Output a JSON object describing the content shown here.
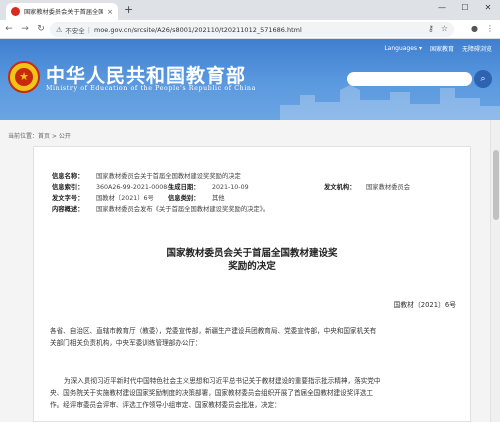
{
  "browser": {
    "tab_title": "国家教材委员会关于首届全国教材...",
    "close_glyph": "×",
    "newtab_glyph": "+",
    "window_controls": [
      "—",
      "☐",
      "✕"
    ],
    "back_glyph": "←",
    "forward_glyph": "→",
    "reload_glyph": "↻",
    "insecure_label": "不安全",
    "separator": "|",
    "url": "moe.gov.cn/srcsite/A26/s8001/202110/t20211012_571686.html",
    "icons": [
      "key-icon",
      "star-icon"
    ],
    "icon_glyphs": {
      "key": "⚷",
      "star": "☆",
      "account": "●",
      "menu": "⋮"
    }
  },
  "header": {
    "title": "中华人民共和国教育部",
    "subtitle": "Ministry of Education of the People's Republic of China",
    "links": [
      "Languages ▾",
      "国家教育",
      "无障碍浏览"
    ],
    "search_glyph": "⌕",
    "emblem_glyph": "★",
    "colors": {
      "top": "#3f7fcf",
      "bottom": "#6aa5e3"
    }
  },
  "breadcrumb": "当前位置：首页 > 公开",
  "meta": {
    "l_name": "信息名称：",
    "v_name": "国家教材委员会关于首届全国教材建设奖奖励的决定",
    "l_index": "信息索引：",
    "v_index": "360A26-99-2021-0008-1",
    "l_date": "生成日期：",
    "v_date": "2021-10-09",
    "l_org": "发文机构：",
    "v_org": "国家教材委员会",
    "l_num": "发文字号：",
    "v_num": "国教材〔2021〕6号",
    "l_cat": "信息类别：",
    "v_cat": "其他",
    "l_summary": "内容概述：",
    "v_summary": "国家教材委员会发布《关于首届全国教材建设奖奖励的决定》。"
  },
  "document": {
    "title_line1": "国家教材委员会关于首届全国教材建设奖",
    "title_line2": "奖励的决定",
    "number": "国教材〔2021〕6号",
    "recipients_line1": "各省、自治区、直辖市教育厅（教委），党委宣传部，新疆生产建设兵团教育局、党委宣传部，中央和国家机关有",
    "recipients_line2": "关部门相关负责机构，中央军委训练管理部办公厅：",
    "body_line1": "为深入贯彻习近平新时代中国特色社会主义思想和习近平总书记关于教材建设的重要指示批示精神，落实党中",
    "body_line2": "央、国务院关于实施教材建设国家奖励制度的决策部署，国家教材委员会组织开展了首届全国教材建设奖评选工",
    "body_line3": "作。经评审委员会评审、评选工作领导小组审定、国家教材委员会批准，决定："
  }
}
